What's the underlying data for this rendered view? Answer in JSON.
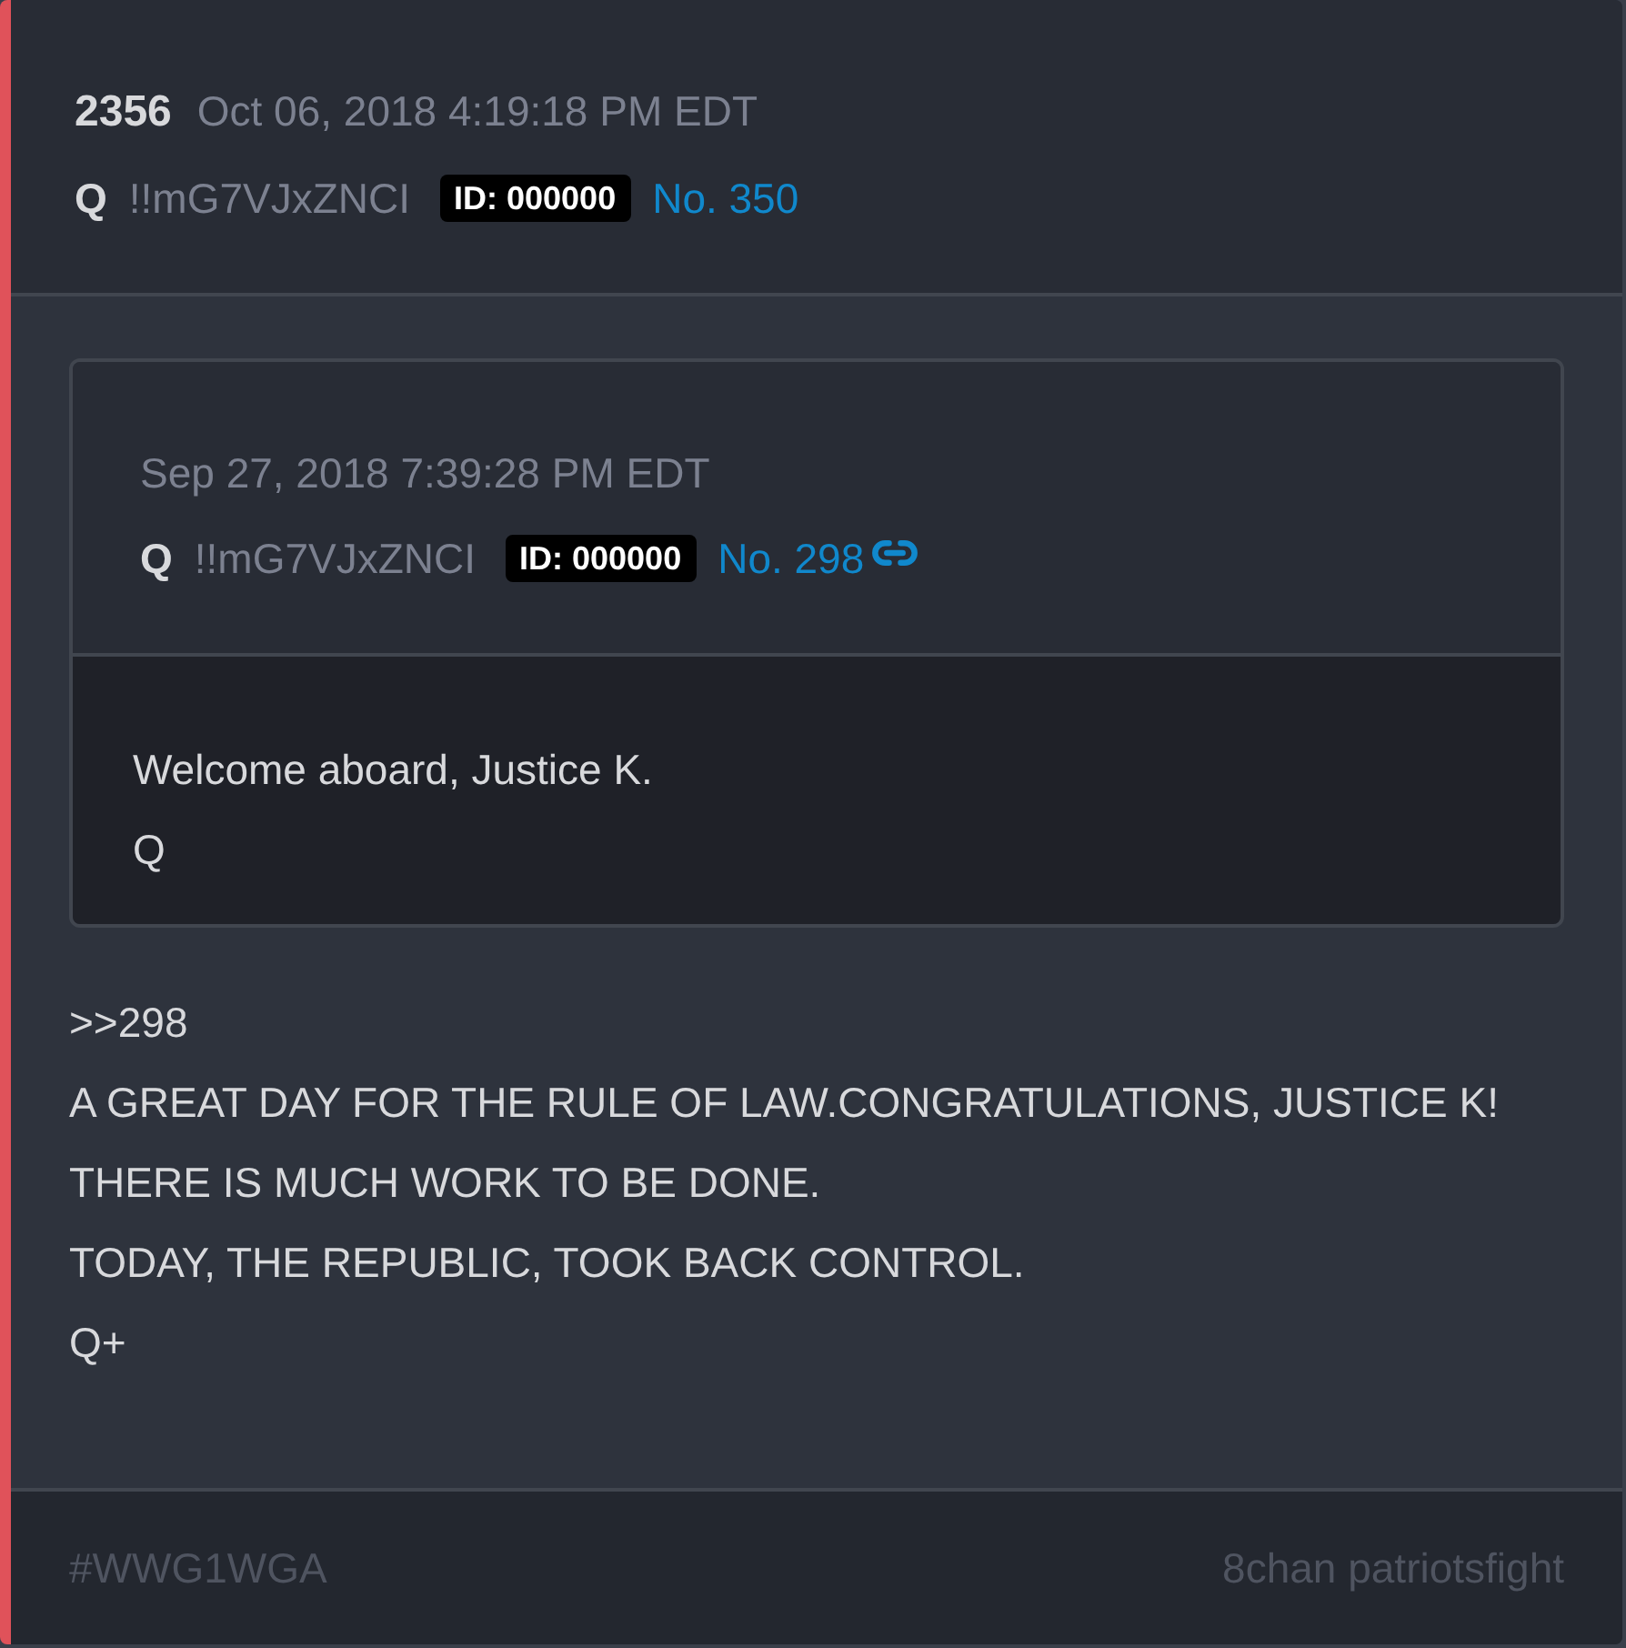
{
  "post": {
    "number": "2356",
    "date": "Oct 06, 2018 4:19:18 PM EDT",
    "name": "Q",
    "tripcode": "!!mG7VJxZNCI",
    "id_badge": "ID: 000000",
    "post_link": "No. 350"
  },
  "quote": {
    "date": "Sep 27, 2018 7:39:28 PM EDT",
    "name": "Q",
    "tripcode": "!!mG7VJxZNCI",
    "id_badge": "ID: 000000",
    "post_link": "No. 298",
    "lines": [
      "Welcome aboard, Justice K.",
      "Q"
    ]
  },
  "body": [
    ">>298",
    "A GREAT DAY FOR THE RULE OF LAW.CONGRATULATIONS, JUSTICE K!",
    "THERE IS MUCH WORK TO BE DONE.",
    "TODAY, THE REPUBLIC, TOOK BACK CONTROL.",
    "Q+"
  ],
  "footer": {
    "tag": "#WWG1WGA",
    "source": "8chan patriotsfight"
  }
}
